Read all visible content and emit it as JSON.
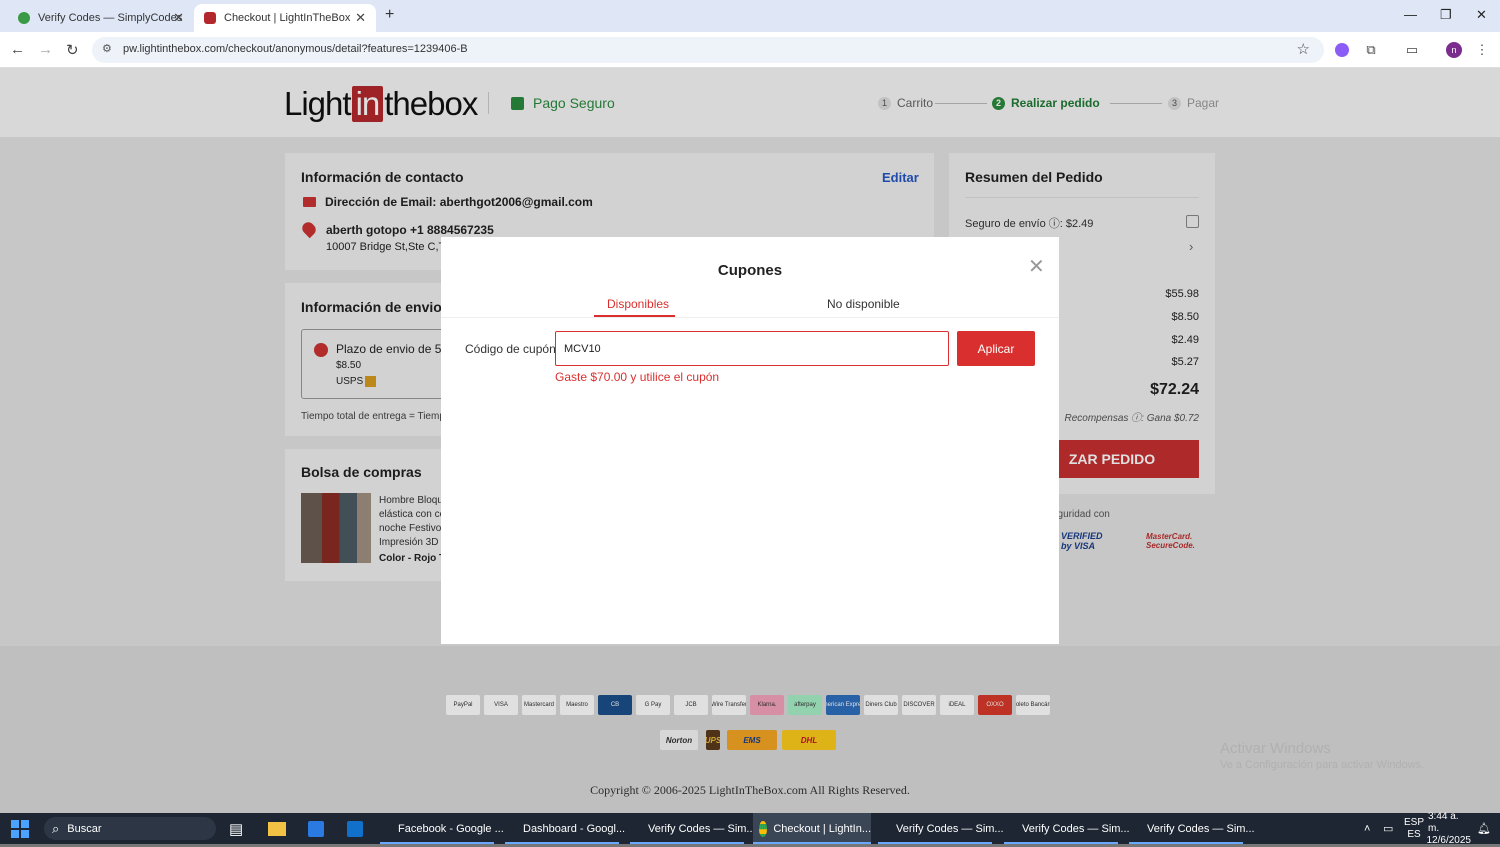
{
  "browser": {
    "tabs": [
      {
        "title": "Verify Codes — SimplyCodes",
        "active": false
      },
      {
        "title": "Checkout | LightInTheBox",
        "active": true
      }
    ],
    "url": "pw.lightinthebox.com/checkout/anonymous/detail?features=1239406-B",
    "profile_initial": "n"
  },
  "header": {
    "logo_pre": "Light",
    "logo_in": "in",
    "logo_post": "thebox",
    "secure_label": "Pago Seguro",
    "steps": [
      {
        "n": "1",
        "label": "Carrito"
      },
      {
        "n": "2",
        "label": "Realizar pedido"
      },
      {
        "n": "3",
        "label": "Pagar"
      }
    ]
  },
  "contact": {
    "title": "Información de contacto",
    "edit": "Editar",
    "email_line": "Dirección de Email: aberthgot2006@gmail.com",
    "name_line": "aberth gotopo +1 8884567235",
    "address": "10007 Bridge St,Ste C,T"
  },
  "shipping": {
    "title": "Información de envio",
    "option": "Plazo de envio de 5 -",
    "price": "$8.50",
    "carrier": "USPS",
    "note": "Tiempo total de entrega = Tiempo"
  },
  "bag": {
    "title": "Bolsa de compras",
    "item_lines": [
      "Hombre Bloque",
      "elástica con co",
      "noche Festivos",
      "Impresión 3D"
    ],
    "variant": "Color - Rojo  T"
  },
  "summary": {
    "title": "Resumen del Pedido",
    "insurance": "Seguro de envío ⓘ: $2.49",
    "amounts": [
      "$55.98",
      "$8.50",
      "$2.49",
      "$5.27"
    ],
    "total": "$72.24",
    "rewards": "Recompensas ⓘ: Gana $0.72",
    "button": "ZAR PEDIDO",
    "security": "eguridad con",
    "verified": "VERIFIED by VISA",
    "mastercard": "MasterCard. SecureCode."
  },
  "footer": {
    "copyright": "Copyright © 2006-2025 LightInTheBox.com All Rights Reserved.",
    "payment_names": [
      "PayPal",
      "VISA",
      "Mastercard",
      "Maestro",
      "CB",
      "G Pay",
      "JCB",
      "Wire Transfer",
      "Klarna.",
      "afterpay",
      "American Express",
      "Diners Club",
      "DISCOVER",
      "iDEAL",
      "OXXO",
      "Boleto Bancário"
    ],
    "shipping_names": [
      "Norton",
      "UPS",
      "EMS",
      "DHL"
    ],
    "watermark_title": "Activar Windows",
    "watermark_sub": "Ve a Configuración para activar Windows."
  },
  "modal": {
    "title": "Cupones",
    "tab_available": "Disponibles",
    "tab_unavailable": "No disponible",
    "label": "Código de cupón",
    "value": "MCV10",
    "apply": "Aplicar",
    "error": "Gaste $70.00 y utilice el cupón"
  },
  "taskbar": {
    "search": "Buscar",
    "apps": [
      "Facebook - Google ...",
      "Dashboard - Googl...",
      "Verify Codes — Sim...",
      "Checkout | LightIn...",
      "Verify Codes — Sim...",
      "Verify Codes — Sim...",
      "Verify Codes — Sim..."
    ],
    "lang1": "ESP",
    "lang2": "ES",
    "time": "3:44 a. m.",
    "date": "12/6/2025"
  }
}
